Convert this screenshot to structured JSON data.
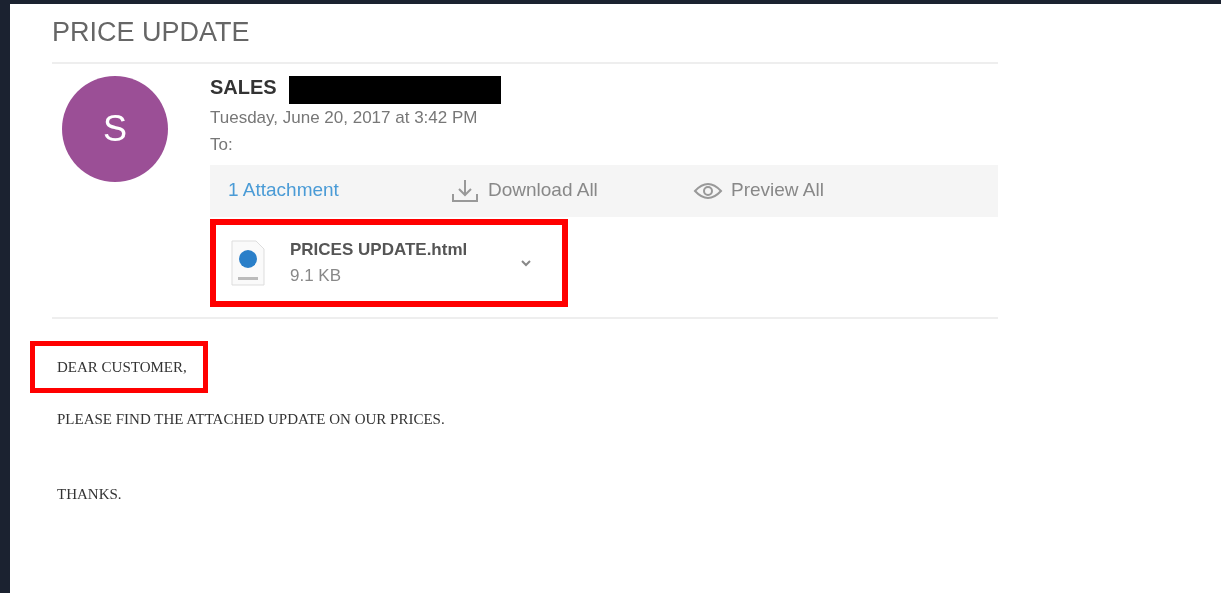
{
  "subject": "PRICE UPDATE",
  "sender": {
    "initial": "S",
    "color": "#9b4f96",
    "name": "SALES",
    "redacted": true
  },
  "date": "Tuesday, June 20, 2017 at 3:42 PM",
  "to_label": "To:",
  "attachments_bar": {
    "count": "1 Attachment",
    "download_all": "Download All",
    "preview_all": "Preview All"
  },
  "attachments": [
    {
      "name": "PRICES UPDATE.html",
      "size": "9.1 KB",
      "highlighted": true
    }
  ],
  "body": [
    {
      "text": "DEAR CUSTOMER,",
      "highlighted": true
    },
    {
      "text": "PLEASE FIND THE ATTACHED UPDATE ON OUR PRICES.",
      "highlighted": false
    },
    {
      "text": "THANKS.",
      "highlighted": false
    }
  ]
}
